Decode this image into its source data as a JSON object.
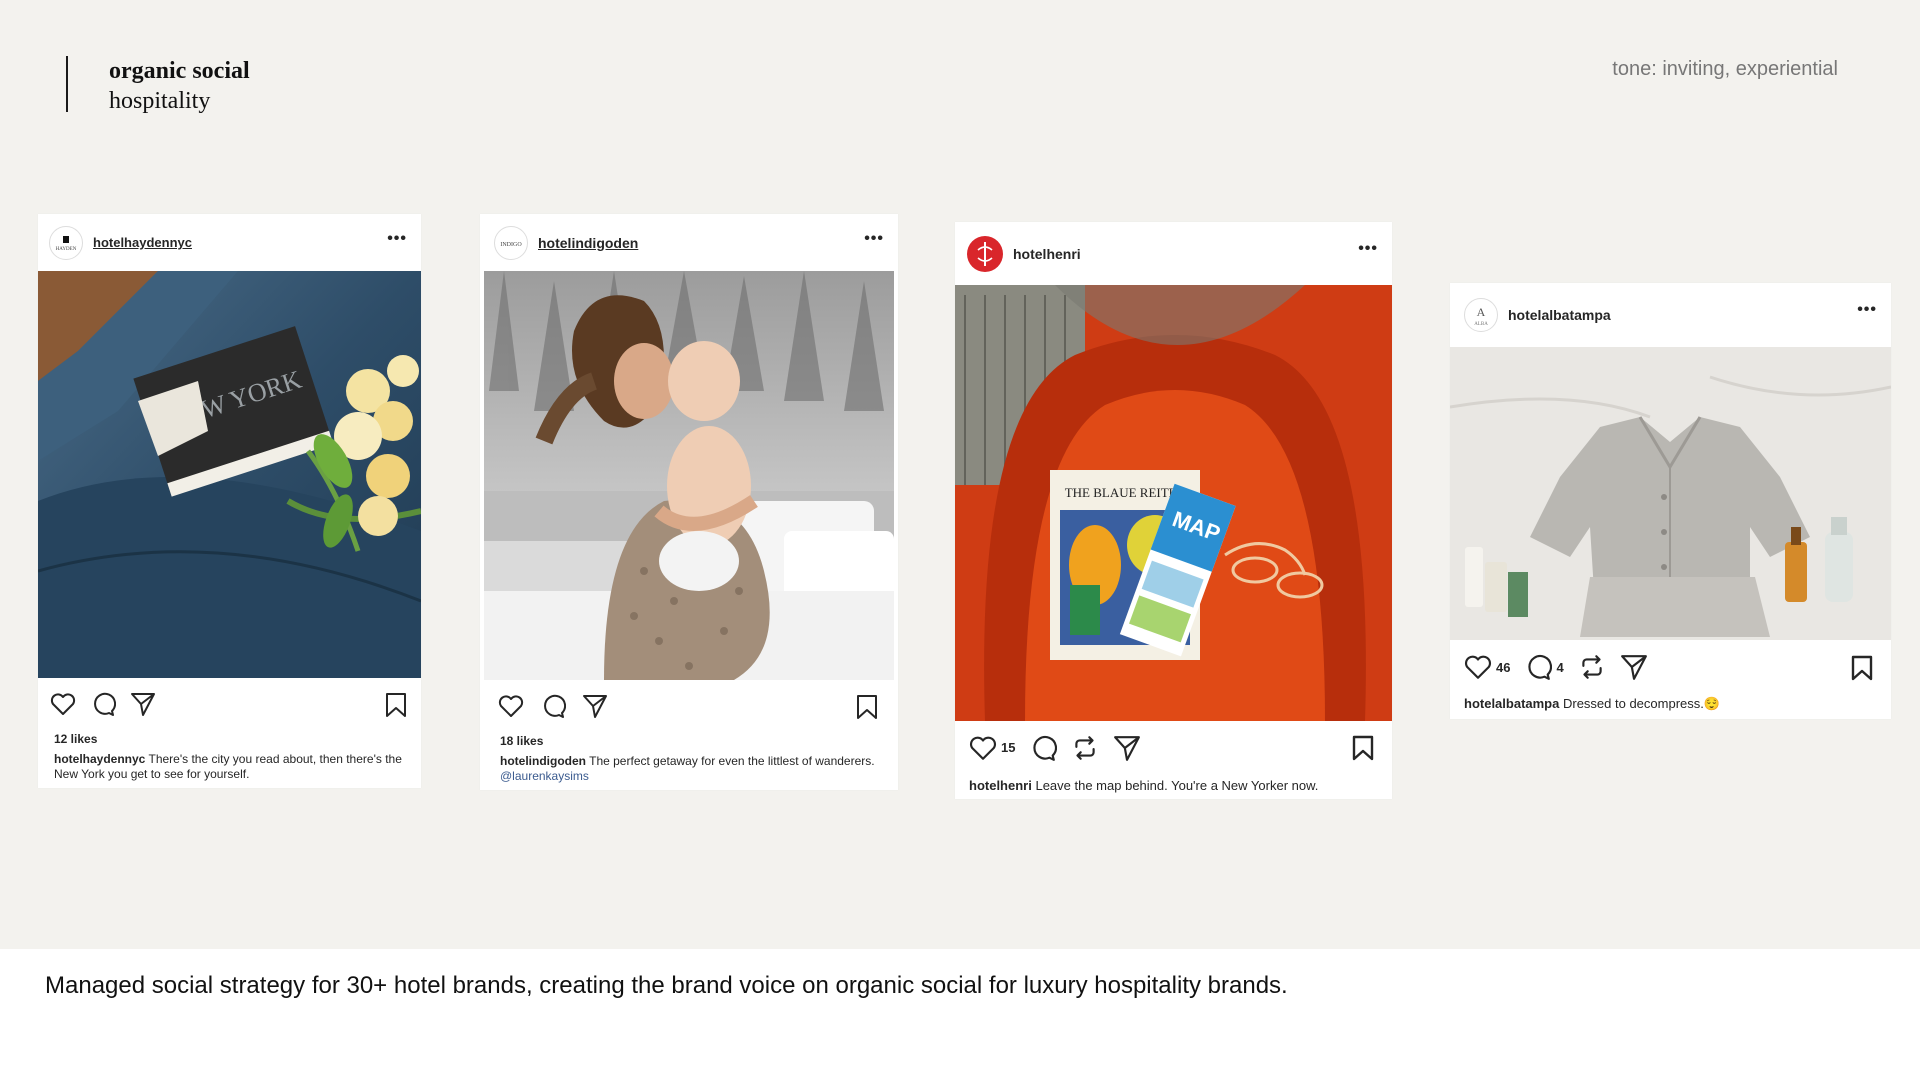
{
  "header": {
    "title": "organic social",
    "subtitle": "hospitality",
    "tone": "tone: inviting, experiential"
  },
  "footer": {
    "caption": "Managed social strategy for 30+ hotel brands, creating the brand voice on organic social for luxury hospitality brands."
  },
  "posts": [
    {
      "handle": "hotelhaydennyc",
      "avatar_text": "HAYDEN",
      "more": "•••",
      "likes": "12 likes",
      "caption_user": "hotelhaydennyc",
      "caption_text": "There's the city you read about, then there's the New York you get to see for yourself.",
      "photo": "book-on-sofa-with-tulips",
      "book_title": "NEW YORK"
    },
    {
      "handle": "hotelindigoden",
      "avatar_text": "INDIGO",
      "more": "•••",
      "likes": "18 likes",
      "caption_user": "hotelindigoden",
      "caption_text": "The perfect getaway for even the littlest of wanderers.",
      "mention": "@laurenkaysims",
      "photo": "mother-holding-baby"
    },
    {
      "handle": "hotelhenri",
      "avatar_text": "H",
      "more": "•••",
      "like_count": "15",
      "caption_user": "hotelhenri",
      "caption_text": "Leave the map behind. You're a New Yorker now.",
      "photo": "book-and-map-on-red-chair",
      "book_title": "THE BLAUE REITER",
      "map_label": "MAP"
    },
    {
      "handle": "hotelalbatampa",
      "avatar_text": "A",
      "avatar_sub": "ALBA",
      "more": "•••",
      "like_count": "46",
      "comment_count": "4",
      "caption_user": "hotelalbatampa",
      "caption_text": "Dressed to decompress.",
      "caption_emoji": "😌",
      "photo": "pajamas-on-bed"
    }
  ],
  "colors": {
    "background": "#f3f2ee",
    "henri_red": "#d9262b",
    "mention": "#3b5b8f"
  }
}
